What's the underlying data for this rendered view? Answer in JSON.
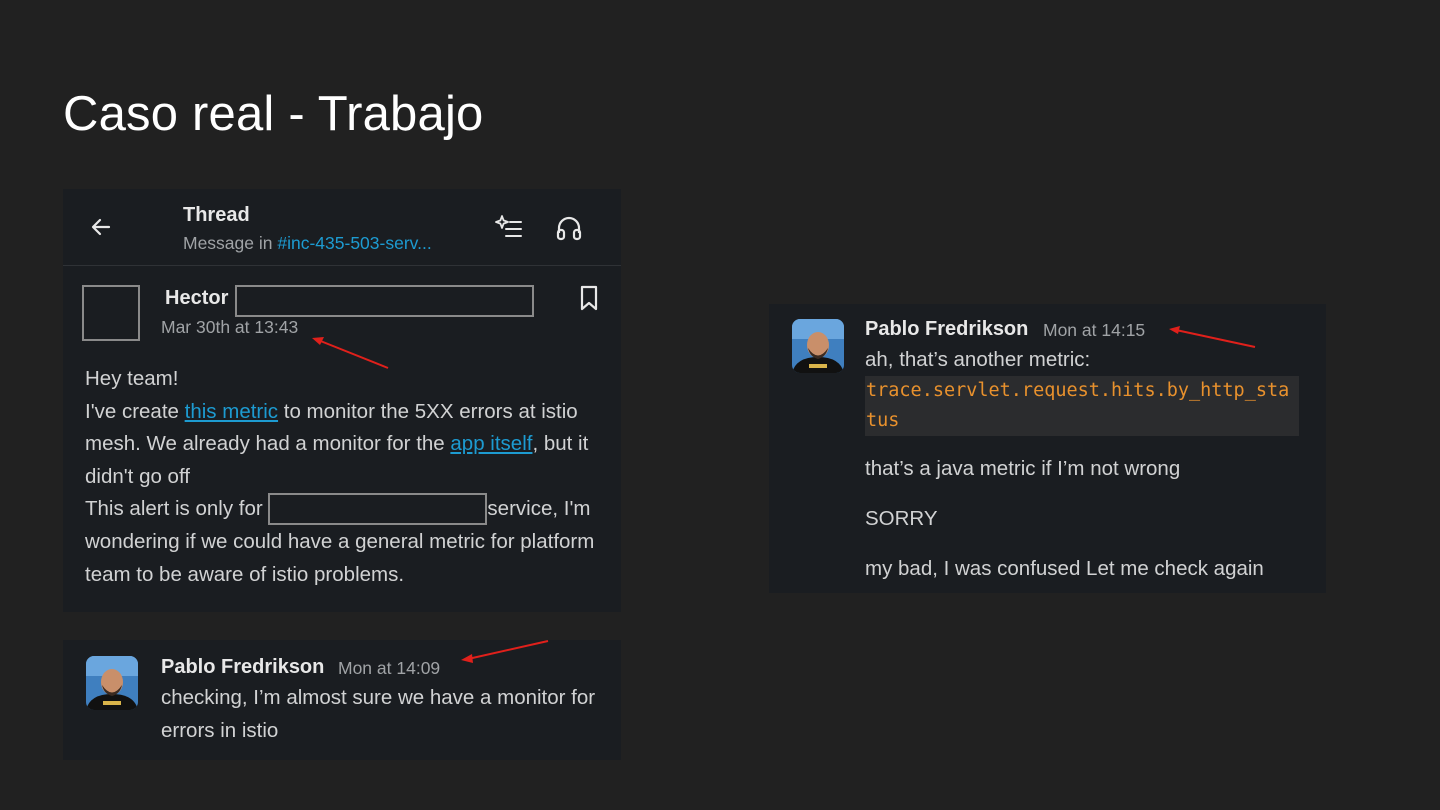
{
  "slide": {
    "title": "Caso real - Trabajo"
  },
  "thread": {
    "header_title": "Thread",
    "header_subtitle_prefix": "Message in ",
    "channel": "#inc-435-503-serv...",
    "icons": {
      "back": "arrow-left-icon",
      "summarize": "sparkle-list-icon",
      "huddle": "headphones-icon",
      "bookmark": "bookmark-icon"
    },
    "message": {
      "author": "Hector",
      "time": "Mar 30th at 13:43",
      "greeting": "Hey team!",
      "line2_a": "I've create ",
      "link_metric": "this metric",
      "line2_b": " to monitor the 5XX errors at istio mesh. We already had a monitor for the ",
      "link_app": "app itself",
      "line2_c": ", but it didn't go off",
      "line3_a": "This alert is only for ",
      "line3_b": "service, I'm wondering if we could have a general metric for platform team to be aware of istio problems."
    }
  },
  "reply1": {
    "author": "Pablo Fredrikson",
    "time": "Mon at 14:09",
    "text": "checking, I’m almost sure we have a monitor for errors in istio"
  },
  "reply2": {
    "author": "Pablo Fredrikson",
    "time": "Mon at 14:15",
    "line1": "ah, that’s another metric:",
    "code": "trace.servlet.request.hits.by_http_status",
    "line2": "that’s a java metric if I’m not wrong",
    "line3": "SORRY",
    "line4": "my bad, I was confused Let me check again"
  },
  "colors": {
    "link": "#1d9bd1",
    "code": "#e8912d",
    "annotation_arrow": "#e0201b",
    "panel": "#1a1d21",
    "slide_bg": "#212121"
  }
}
